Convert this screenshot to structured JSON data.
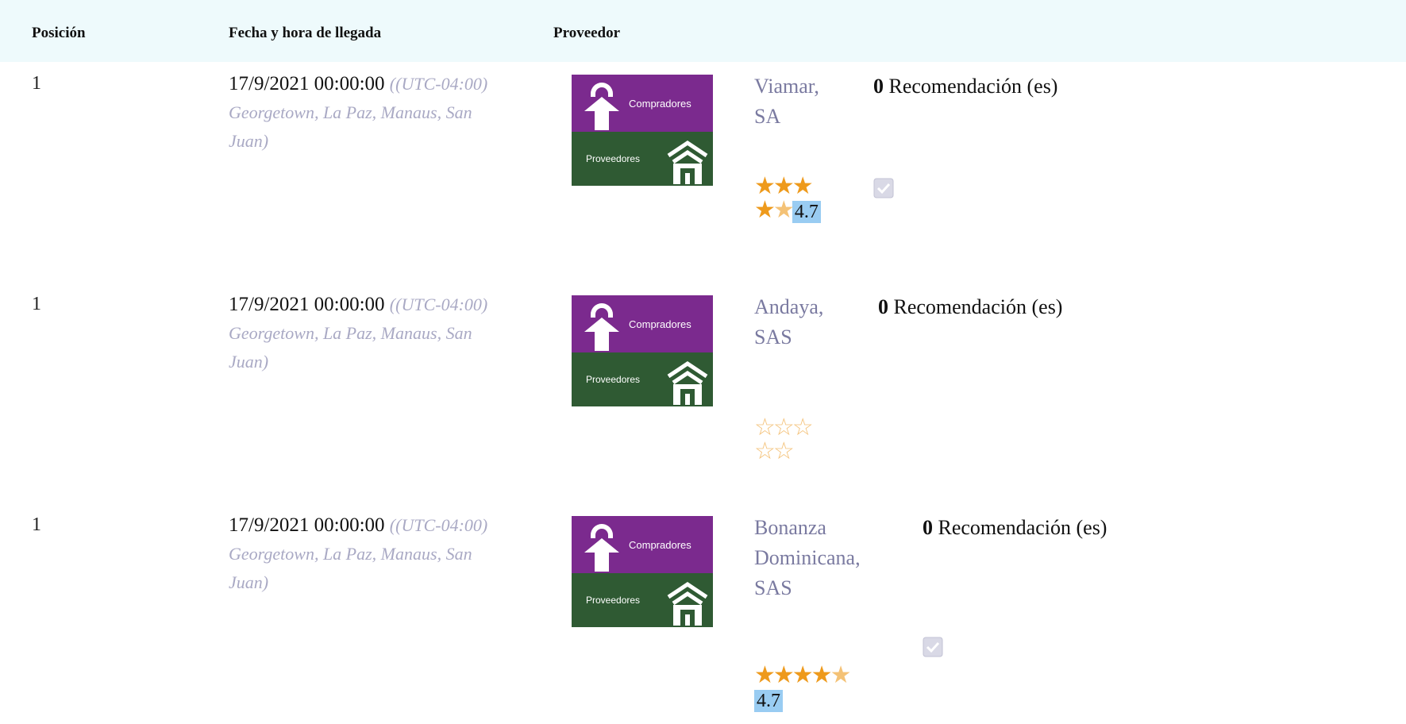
{
  "header": {
    "col_position": "Posición",
    "col_datetime": "Fecha y hora de llegada",
    "col_supplier": "Proveedor"
  },
  "logo": {
    "top_label": "Compradores",
    "bottom_label": "Proveedores"
  },
  "rows": [
    {
      "position": "1",
      "datetime": "17/9/2021 00:00:00",
      "timezone": "((UTC-04:00) Georgetown, La Paz, Manaus, San Juan)",
      "supplier": "Viamar, SA",
      "recommendations_count": "0",
      "recommendations_label": "Recomendación (es)",
      "stars_filled": 4.5,
      "rating": "4.7",
      "verified": true
    },
    {
      "position": "1",
      "datetime": "17/9/2021 00:00:00",
      "timezone": "((UTC-04:00) Georgetown, La Paz, Manaus, San Juan)",
      "supplier": "Andaya, SAS",
      "recommendations_count": "0",
      "recommendations_label": "Recomendación (es)",
      "stars_filled": 0,
      "rating": "",
      "verified": false
    },
    {
      "position": "1",
      "datetime": "17/9/2021 00:00:00",
      "timezone": "((UTC-04:00) Georgetown, La Paz, Manaus, San Juan)",
      "supplier": "Bonanza Dominicana, SAS",
      "recommendations_count": "0",
      "recommendations_label": "Recomendación (es)",
      "stars_filled": 4.5,
      "rating": "4.7",
      "verified": true
    }
  ],
  "colors": {
    "header_bg": "#eefafc",
    "logo_purple": "#7b2a8e",
    "logo_green": "#2f5a33",
    "star": "#ee9a1c",
    "rating_bg": "#99ccf2"
  }
}
